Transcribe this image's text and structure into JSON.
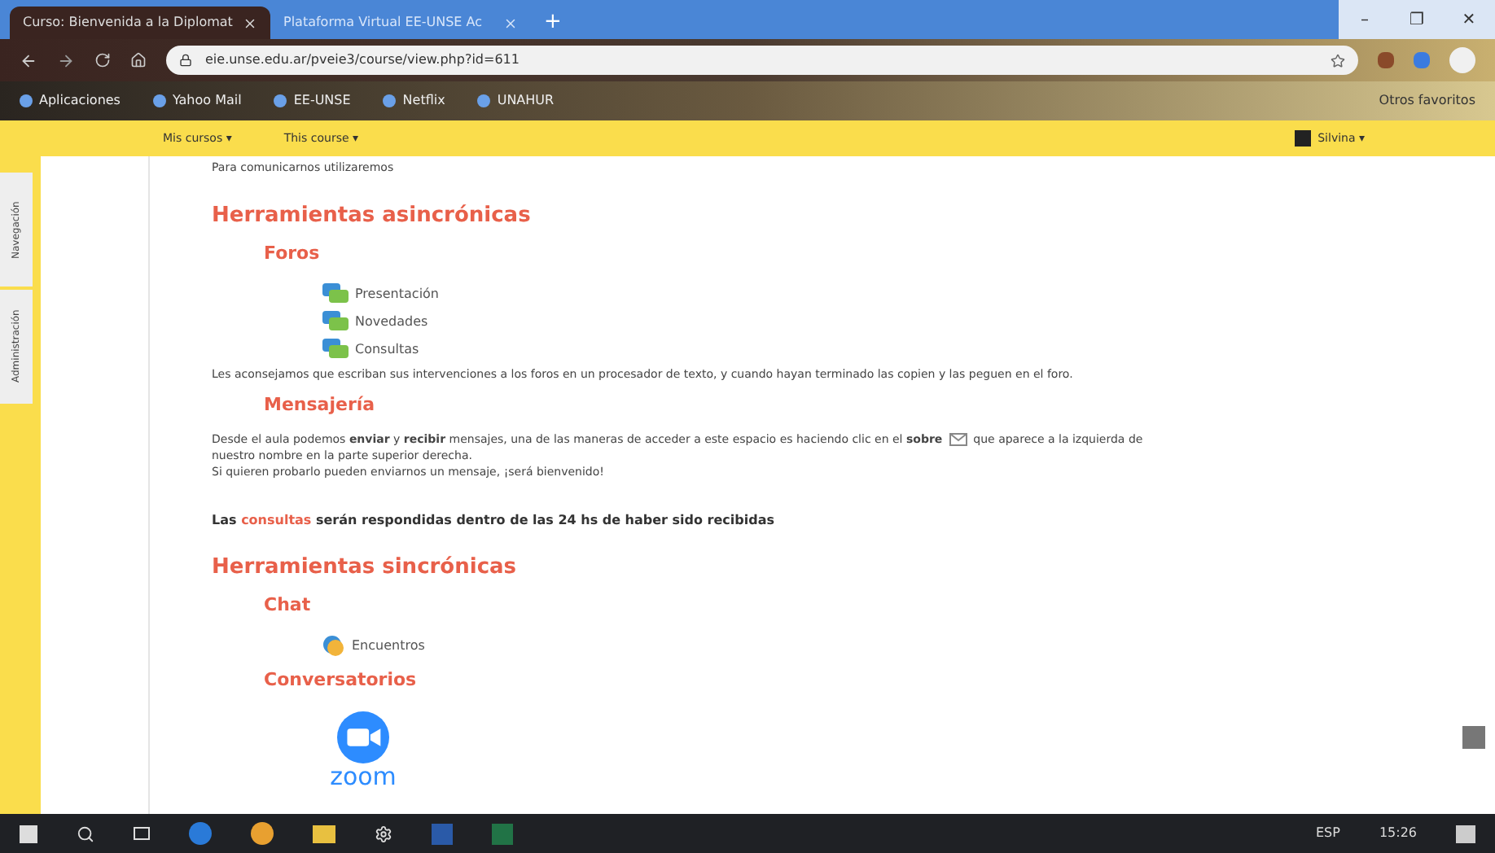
{
  "browser": {
    "tabs": [
      {
        "title": "Curso: Bienvenida a la Diplomat",
        "selected": true
      },
      {
        "title": "Plataforma Virtual EE-UNSE Ac",
        "selected": false
      }
    ],
    "new_tab": "+",
    "window_controls": [
      "–",
      "❐",
      "✕"
    ],
    "url": "eie.unse.edu.ar/pveie3/course/view.php?id=611",
    "bookmarks": [
      {
        "label": "Aplicaciones"
      },
      {
        "label": "Yahoo Mail"
      },
      {
        "label": "EE-UNSE"
      },
      {
        "label": "Netflix"
      },
      {
        "label": "UNAHUR"
      }
    ],
    "other_bookmarks": "Otros favoritos"
  },
  "navbar": {
    "left": [
      "Mis cursos ▾",
      "This course ▾"
    ],
    "user": "Silvina ▾"
  },
  "side_tabs": [
    "Navegación",
    "Administración"
  ],
  "content": {
    "intro": "Para comunicarnos utilizaremos",
    "sections": [
      {
        "title": "Herramientas asincrónicas",
        "groups": [
          {
            "title": "Foros",
            "items": [
              {
                "label": "Presentación",
                "kind": "forum"
              },
              {
                "label": "Novedades",
                "kind": "forum"
              },
              {
                "label": "Consultas",
                "kind": "forum"
              }
            ],
            "note": "Les aconsejamos que escriban sus intervenciones a los foros en un procesador de texto, y cuando hayan terminado las copien y las peguen en el foro."
          },
          {
            "title": "Mensajería",
            "paragraph_before": "Desde el aula podemos **enviar** y **recibir** mensajes, una de las maneras de acceder a este espacio es haciendo clic en el **sobre**",
            "paragraph_after": "que aparece a la izquierda de",
            "paragraph_continued": "nuestro nombre en la parte superior derecha.",
            "paragraph_2": "Si quieren probarlo pueden enviarnos un mensaje, ¡será bienvenido!",
            "notice": {
              "before": "Las",
              "highlight": "consultas",
              "after": "serán respondidas dentro de las 24 hs de haber sido recibidas"
            }
          }
        ]
      },
      {
        "title": "Herramientas sincrónicas",
        "groups": [
          {
            "title": "Chat",
            "items": [
              {
                "label": "Encuentros",
                "kind": "chat"
              }
            ]
          },
          {
            "title": "Conversatorios",
            "logo": {
              "kind": "zoom",
              "text": "zoom"
            }
          }
        ]
      }
    ]
  },
  "taskbar": {
    "language": "ESP",
    "time": "15:26"
  }
}
